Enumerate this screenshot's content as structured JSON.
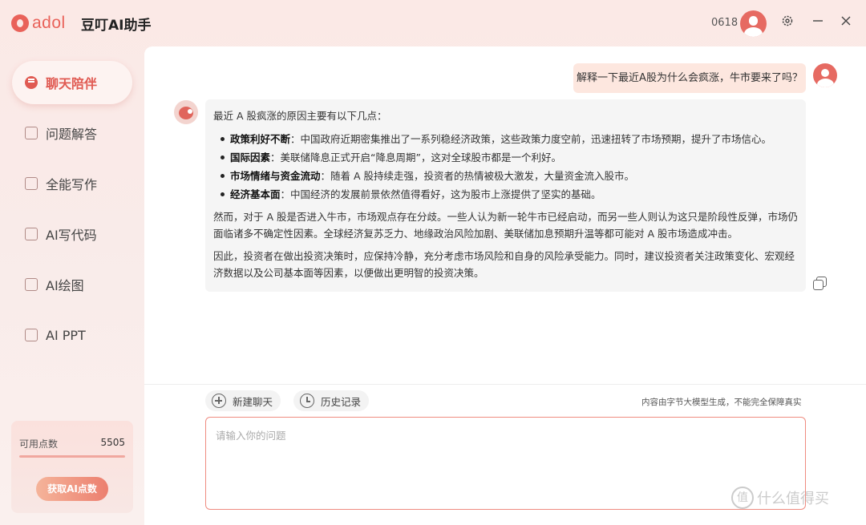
{
  "brand": {
    "logo_text": "adol",
    "app_title": "豆叮AI助手"
  },
  "header": {
    "user_id": "0618",
    "settings_icon": "gear-icon",
    "minimize_icon": "minus-icon",
    "close_icon": "close-icon"
  },
  "sidebar": {
    "items": [
      {
        "label": "聊天陪伴",
        "icon": "chat-bubble-icon",
        "active": true
      },
      {
        "label": "问题解答",
        "icon": "document-list-icon",
        "active": false
      },
      {
        "label": "全能写作",
        "icon": "pen-document-icon",
        "active": false
      },
      {
        "label": "AI写代码",
        "icon": "code-icon",
        "active": false
      },
      {
        "label": "AI绘图",
        "icon": "image-icon",
        "active": false
      },
      {
        "label": "AI PPT",
        "icon": "ppt-file-icon",
        "active": false
      }
    ],
    "points": {
      "label": "可用点数",
      "value": "5505",
      "fill_fraction": 1.0,
      "button_label": "获取AI点数"
    }
  },
  "chat": {
    "user_message": "解释一下最近A股为什么会疯涨，牛市要来了吗？",
    "bot_message": {
      "intro": "最近 A 股疯涨的原因主要有以下几点：",
      "bullets": [
        {
          "title": "政策利好不断",
          "text": "：中国政府近期密集推出了一系列稳经济政策，这些政策力度空前，迅速扭转了市场预期，提升了市场信心。"
        },
        {
          "title": "国际因素",
          "text": "：美联储降息正式开启“降息周期”，这对全球股市都是一个利好。"
        },
        {
          "title": "市场情绪与资金流动",
          "text": "：随着 A 股持续走强，投资者的热情被极大激发，大量资金流入股市。"
        },
        {
          "title": "经济基本面",
          "text": "：中国经济的发展前景依然值得看好，这为股市上涨提供了坚实的基础。"
        }
      ],
      "paragraph_1": "然而，对于 A 股是否进入牛市，市场观点存在分歧。一些人认为新一轮牛市已经启动，而另一些人则认为这只是阶段性反弹，市场仍面临诸多不确定性因素。全球经济复苏乏力、地缘政治风险加剧、美联储加息预期升温等都可能对 A 股市场造成冲击。",
      "paragraph_2": "因此，投资者在做出投资决策时，应保持冷静，充分考虑市场风险和自身的风险承受能力。同时，建议投资者关注政策变化、宏观经济数据以及公司基本面等因素，以便做出更明智的投资决策。"
    }
  },
  "toolbar": {
    "new_chat_label": "新建聊天",
    "history_label": "历史记录",
    "disclaimer": "内容由字节大模型生成，不能完全保障真实"
  },
  "input": {
    "placeholder": "请输入你的问题",
    "value": ""
  },
  "watermark": {
    "text": "什么值得买",
    "mark": "值"
  }
}
